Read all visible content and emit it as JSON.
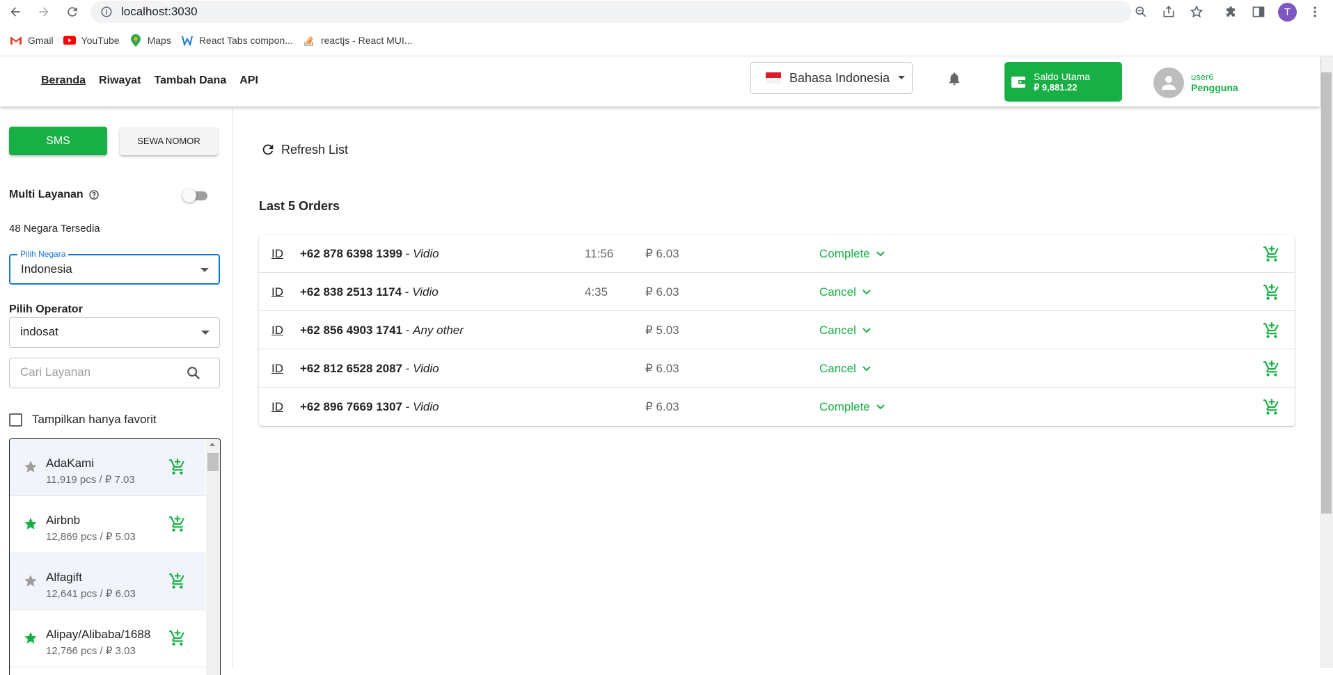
{
  "browser": {
    "url": "localhost:3030",
    "profile_initial": "T",
    "bookmarks": [
      {
        "label": "Gmail",
        "icon": "gmail-icon"
      },
      {
        "label": "YouTube",
        "icon": "youtube-icon"
      },
      {
        "label": "Maps",
        "icon": "maps-icon"
      },
      {
        "label": "React Tabs compon...",
        "icon": "react-icon"
      },
      {
        "label": "reactjs - React MUI...",
        "icon": "stackoverflow-icon"
      }
    ]
  },
  "header": {
    "nav": [
      "Beranda",
      "Riwayat",
      "Tambah Dana",
      "API"
    ],
    "active_nav": "Beranda",
    "language": "Bahasa Indonesia",
    "balance_label": "Saldo Utama",
    "balance_amount": "₽ 9,881.22",
    "user_name": "user6",
    "user_role": "Pengguna",
    "accent_color": "#18b046"
  },
  "sidebar": {
    "tab_sms": "SMS",
    "tab_sewa": "SEWA NOMOR",
    "multi_label": "Multi Layanan",
    "multi_enabled": false,
    "countries_available": "48 Negara Tersedia",
    "country_field_label": "Pilih Negara",
    "country_value": "Indonesia",
    "operator_label": "Pilih Operator",
    "operator_value": "indosat",
    "search_placeholder": "Cari Layanan",
    "favorites_label": "Tampilkan hanya favorit",
    "favorites_checked": false,
    "services": [
      {
        "name": "AdaKami",
        "meta": "11,919 pcs / ₽ 7.03",
        "favorite": false
      },
      {
        "name": "Airbnb",
        "meta": "12,869 pcs / ₽ 5.03",
        "favorite": true
      },
      {
        "name": "Alfagift",
        "meta": "12,641 pcs / ₽ 6.03",
        "favorite": false
      },
      {
        "name": "Alipay/Alibaba/1688",
        "meta": "12,766 pcs / ₽ 3.03",
        "favorite": true
      }
    ]
  },
  "main": {
    "refresh_label": "Refresh List",
    "orders_title": "Last 5 Orders",
    "orders": [
      {
        "country": "ID",
        "phone": "+62 878 6398 1399",
        "service": "Vidio",
        "time": "11:56",
        "price": "₽ 6.03",
        "status": "Complete"
      },
      {
        "country": "ID",
        "phone": "+62 838 2513 1174",
        "service": "Vidio",
        "time": "4:35",
        "price": "₽ 6.03",
        "status": "Cancel"
      },
      {
        "country": "ID",
        "phone": "+62 856 4903 1741",
        "service": "Any other",
        "time": "",
        "price": "₽ 5.03",
        "status": "Cancel"
      },
      {
        "country": "ID",
        "phone": "+62 812 6528 2087",
        "service": "Vidio",
        "time": "",
        "price": "₽ 6.03",
        "status": "Cancel"
      },
      {
        "country": "ID",
        "phone": "+62 896 7669 1307",
        "service": "Vidio",
        "time": "",
        "price": "₽ 6.03",
        "status": "Complete"
      }
    ]
  }
}
